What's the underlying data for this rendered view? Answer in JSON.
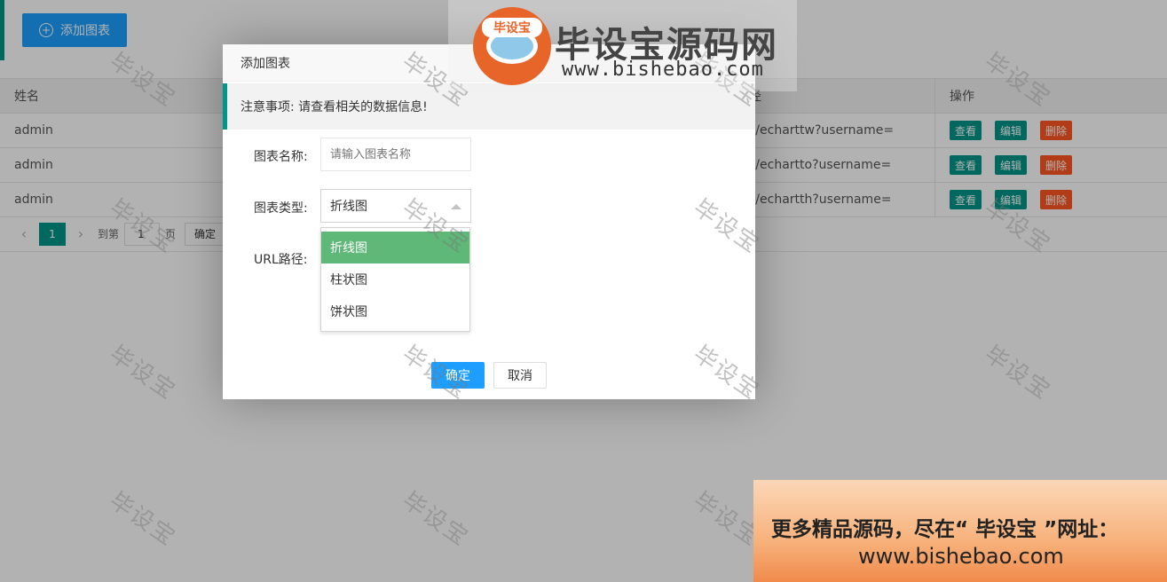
{
  "toolbar": {
    "add_label": "添加图表"
  },
  "table": {
    "headers": {
      "name": "姓名",
      "url": "径",
      "op": "操作"
    },
    "rows": [
      {
        "name": "admin",
        "url": "s/echarttw?username="
      },
      {
        "name": "admin",
        "url": "s/echartto?username="
      },
      {
        "name": "admin",
        "url": "s/echartth?username="
      }
    ],
    "actions": {
      "view": "查看",
      "edit": "编辑",
      "delete": "删除"
    }
  },
  "pager": {
    "prev": "‹",
    "current": "1",
    "next": "›",
    "goto_label": "到第",
    "goto_value": "1",
    "page_suffix": "页",
    "confirm": "确定"
  },
  "dialog": {
    "title": "添加图表",
    "notice": "注意事项: 请查看相关的数据信息!",
    "name_label": "图表名称:",
    "name_placeholder": "请输入图表名称",
    "type_label": "图表类型:",
    "type_value": "折线图",
    "options": [
      "折线图",
      "柱状图",
      "饼状图"
    ],
    "url_label": "URL路径:",
    "ok": "确定",
    "cancel": "取消"
  },
  "watermark": {
    "text": "毕设宝",
    "logo_tag": "毕设宝",
    "logo_name": "毕设宝源码网",
    "logo_url": "www.bishebao.com",
    "promo_line1": "更多精品源码，尽在“ 毕设宝 ”网址：",
    "promo_line2": "www.bishebao.com"
  },
  "colors": {
    "primary": "#1e9fff",
    "teal": "#009688",
    "danger": "#ff5722",
    "option_active": "#5fb878"
  }
}
